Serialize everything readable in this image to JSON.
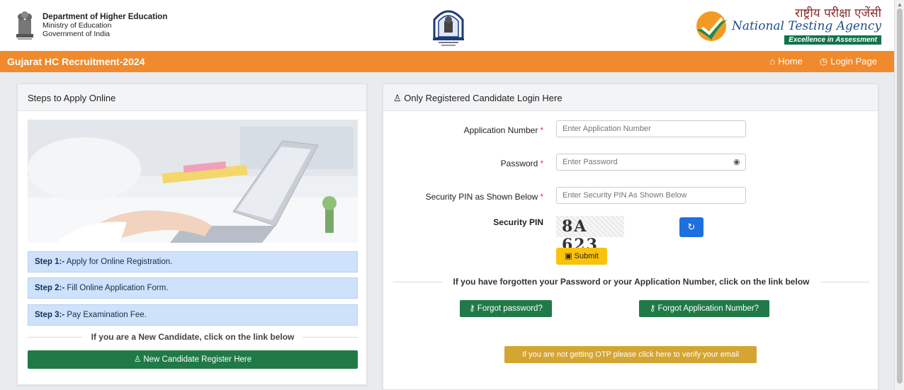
{
  "header": {
    "dept_title": "Department of Higher Education",
    "dept_line2": "Ministry of Education",
    "dept_line3": "Government of India",
    "nta_hindi": "राष्ट्रीय परीक्षा एजेंसी",
    "nta_english": "National Testing Agency",
    "nta_tagline": "Excellence in Assessment"
  },
  "navbar": {
    "title": "Gujarat HC Recruitment-2024",
    "home_label": "Home",
    "login_label": "Login Page"
  },
  "left_panel": {
    "heading": "Steps to Apply Online",
    "steps": [
      {
        "label": "Step 1:-",
        "text": " Apply for Online Registration."
      },
      {
        "label": "Step 2:-",
        "text": " Fill Online Application Form."
      },
      {
        "label": "Step 3:-",
        "text": " Pay Examination Fee."
      }
    ],
    "new_candidate_text": "If you are a New Candidate, click on the link below",
    "register_button": "New Candidate Register Here"
  },
  "right_panel": {
    "heading": "Only Registered Candidate Login Here",
    "application_number_label": "Application Number",
    "application_number_placeholder": "Enter Application Number",
    "password_label": "Password",
    "password_placeholder": "Enter Password",
    "security_pin_label": "Security PIN as Shown Below",
    "security_pin_placeholder": "Enter Security PIN As Shown Below",
    "security_pin_caption": "Security PIN",
    "captcha_text": "8A 623",
    "submit_label": "Submit",
    "forgot_text": "If you have forgotten your Password or your Application Number, click on the link below",
    "forgot_password_button": "Forgot password?",
    "forgot_appno_button": "Forgot Application Number?",
    "otp_button": "If you are not getting OTP please click here to verify your email"
  },
  "colors": {
    "navbar": "#f08a2c",
    "green_button": "#1f7a47",
    "step_bg": "#cfe2fb",
    "submit": "#f9c20b",
    "otp": "#d4a531",
    "refresh": "#1e6fe0"
  }
}
